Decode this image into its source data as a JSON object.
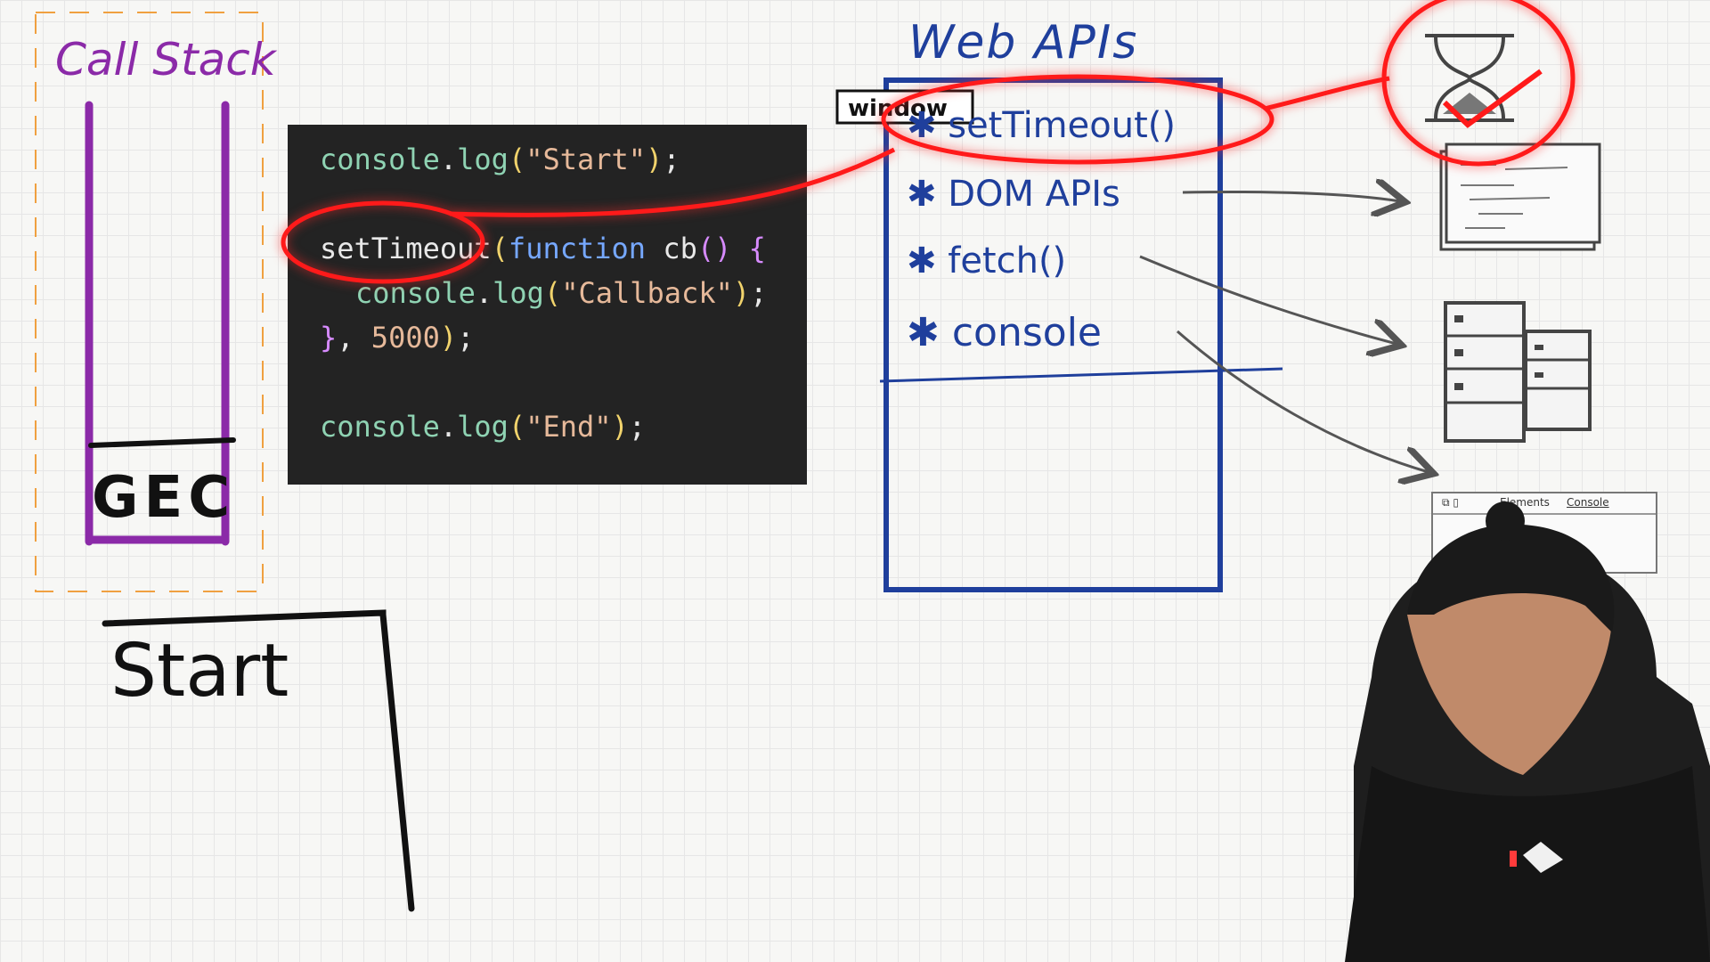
{
  "call_stack": {
    "title": "Call Stack",
    "frame_label": "GEC"
  },
  "code": {
    "lines": [
      {
        "id": "console",
        "dot": ".",
        "fn": "log",
        "open": "(",
        "str": "\"Start\"",
        "close": ")",
        "semi": ";"
      },
      {
        "id": "setTimeout",
        "open": "(",
        "kw": "function",
        "name": " cb",
        "parens": "()",
        "brace": " {"
      },
      {
        "id": "console",
        "dot": ".",
        "fn": "log",
        "open": "(",
        "str": "\"Callback\"",
        "close": ")",
        "semi": ";"
      },
      {
        "close_brace": "}",
        "comma": ", ",
        "num": "5000",
        "close": ")",
        "semi": ";"
      },
      {
        "id": "console",
        "dot": ".",
        "fn": "log",
        "open": "(",
        "str": "\"End\"",
        "close": ")",
        "semi": ";"
      }
    ]
  },
  "web_apis": {
    "title": "Web APIs",
    "window_label": "window",
    "items": [
      "setTimeout()",
      "DOM APIs",
      "fetch()",
      "console"
    ]
  },
  "console_output": {
    "lines": [
      "Start"
    ]
  },
  "devtools": {
    "tab_elements": "Elements",
    "tab_console": "Console"
  },
  "colors": {
    "call_stack": "#8b2aa8",
    "web_apis": "#1f3f9c",
    "highlight": "#ff1a1a",
    "ink": "#111111",
    "code_bg": "#232323",
    "dashed": "#f0a040"
  },
  "icons": [
    "hourglass-icon",
    "html-document-icon",
    "server-icon",
    "devtools-console-icon"
  ]
}
